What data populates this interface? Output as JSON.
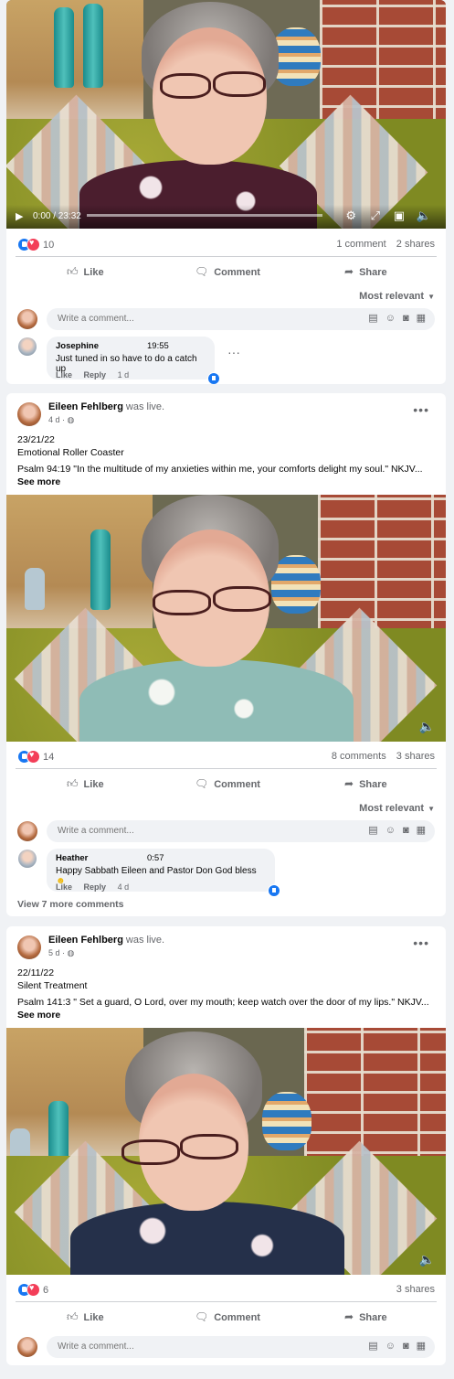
{
  "post1": {
    "video": {
      "time": "0:00 / 23:32"
    },
    "reaction_count": "10",
    "comments_count": "1 comment",
    "shares_count": "2 shares",
    "actions": {
      "like": "Like",
      "comment": "Comment",
      "share": "Share"
    },
    "sort": "Most relevant",
    "composer_placeholder": "Write a comment...",
    "comment": {
      "author": "Josephine",
      "time": "19:55",
      "text": "Just tuned in so have to do a catch up",
      "like": "Like",
      "reply": "Reply",
      "age": "1 d"
    }
  },
  "post2": {
    "author": "Eileen Fehlberg",
    "status": "was live.",
    "meta": "4 d · ",
    "date_line": "23/21/22",
    "title_line": "Emotional Roller Coaster",
    "verse": "Psalm 94:19 \"In the multitude of my anxieties within me, your comforts delight my soul.\" NKJV...",
    "see_more": "See more",
    "reaction_count": "14",
    "comments_count": "8 comments",
    "shares_count": "3 shares",
    "actions": {
      "like": "Like",
      "comment": "Comment",
      "share": "Share"
    },
    "sort": "Most relevant",
    "composer_placeholder": "Write a comment...",
    "comment": {
      "author": "Heather",
      "time": "0:57",
      "text": "Happy Sabbath Eileen and Pastor Don God bless",
      "like": "Like",
      "reply": "Reply",
      "age": "4 d"
    },
    "view_more": "View 7 more comments"
  },
  "post3": {
    "author": "Eileen Fehlberg",
    "status": "was live.",
    "meta": "5 d · ",
    "date_line": "22/11/22",
    "title_line": "Silent Treatment",
    "verse": "Psalm 141:3 \" Set a guard, O Lord, over my mouth; keep watch over the door of my lips.\" NKJV...",
    "see_more": "See more",
    "reaction_count": "6",
    "shares_count": "3 shares",
    "actions": {
      "like": "Like",
      "comment": "Comment",
      "share": "Share"
    },
    "composer_placeholder": "Write a comment..."
  },
  "icons": {
    "like": "thumbs-up-icon",
    "comment": "speech-bubble-icon",
    "share": "share-arrow-icon",
    "globe": "globe-icon"
  },
  "colors": {
    "like_blue": "#1877f2",
    "love_red": "#f33e58",
    "secondary_text": "#65676b",
    "page_bg": "#f0f2f5"
  }
}
